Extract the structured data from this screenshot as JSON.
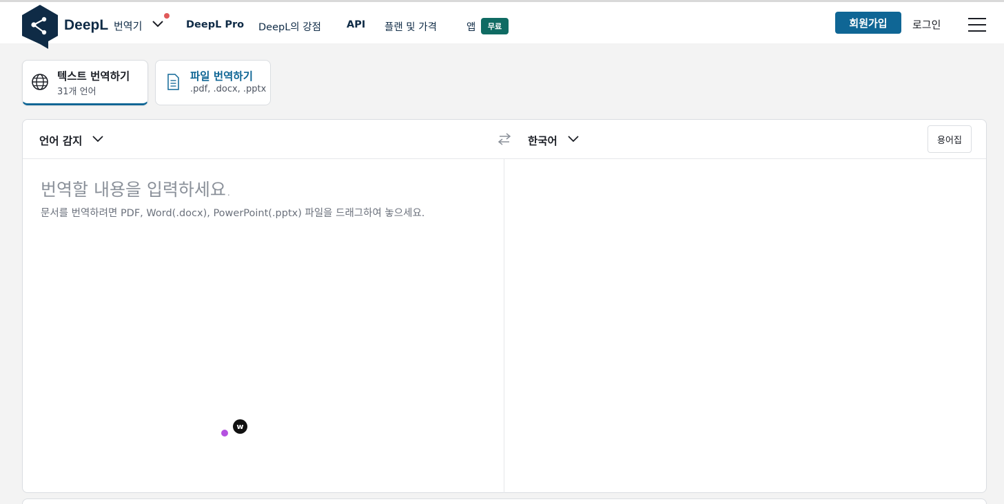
{
  "header": {
    "brand": "DeepL",
    "product": "번역기",
    "nav": {
      "pro": "DeepL Pro",
      "strengths": "DeepL의 강점",
      "api": "API",
      "pricing": "플랜 및 가격",
      "apps": "앱",
      "apps_badge": "무료"
    },
    "signup": "회원가입",
    "login": "로그인"
  },
  "modes": {
    "text": {
      "title": "텍스트 번역하기",
      "subtitle": "31개 언어",
      "icon": "globe-icon"
    },
    "file": {
      "title": "파일 번역하기",
      "subtitle": ".pdf, .docx, .pptx",
      "icon": "document-icon"
    }
  },
  "translator": {
    "source_language": "언어 감지",
    "target_language": "한국어",
    "glossary": "용어집",
    "placeholder_main": "번역할 내용을 입력하세요.",
    "placeholder_sub": "문서를 번역하려면 PDF, Word(.docx), PowerPoint(.pptx) 파일을 드래그하여 놓으세요.",
    "extension_badge": "w"
  },
  "colors": {
    "brand_navy": "#0f2b46",
    "primary_button": "#0f6695",
    "free_badge": "#0f6b63",
    "notification_dot": "#e05a5a",
    "background": "#f3f3f3"
  }
}
